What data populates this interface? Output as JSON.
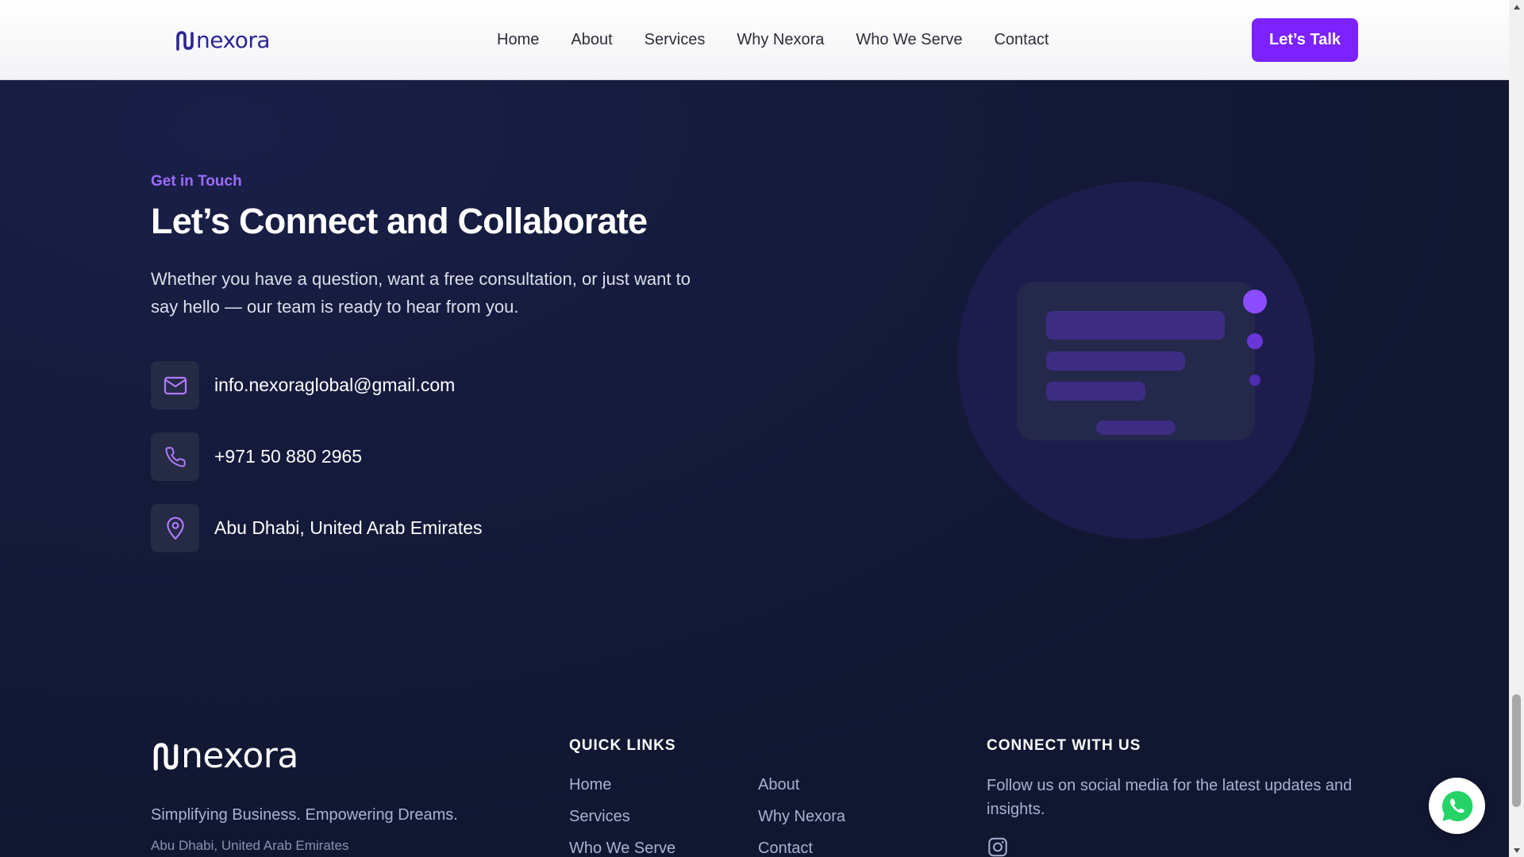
{
  "header": {
    "logo_text": "nexora",
    "nav": [
      "Home",
      "About",
      "Services",
      "Why Nexora",
      "Who We Serve",
      "Contact"
    ],
    "cta_label": "Let’s Talk"
  },
  "contact": {
    "eyebrow": "Get in Touch",
    "heading": "Let’s Connect and Collaborate",
    "intro": "Whether you have a question, want a free consultation, or just want to say hello — our team is ready to hear from you.",
    "email": "info.nexoraglobal@gmail.com",
    "phone": "+971 50 880 2965",
    "location": "Abu Dhabi, United Arab Emirates",
    "icons": [
      "mail-icon",
      "phone-icon",
      "map-pin-icon"
    ]
  },
  "footer": {
    "logo_text": "nexora",
    "tagline": "Simplifying Business. Empowering Dreams.",
    "address": "Abu Dhabi, United Arab Emirates",
    "quick_links_title": "QUICK LINKS",
    "quick_links": [
      "Home",
      "About",
      "Services",
      "Why Nexora",
      "Who We Serve",
      "Contact"
    ],
    "connect_title": "CONNECT WITH US",
    "connect_text": "Follow us on social media for the latest updates and insights.",
    "social_icons": [
      "instagram-icon"
    ]
  },
  "floating": {
    "whatsapp_icon": "whatsapp-icon"
  },
  "colors": {
    "accent": "#7b22ff",
    "eyebrow": "#9d6bff",
    "background": "#111731",
    "brand_logo": "#2b2593"
  }
}
